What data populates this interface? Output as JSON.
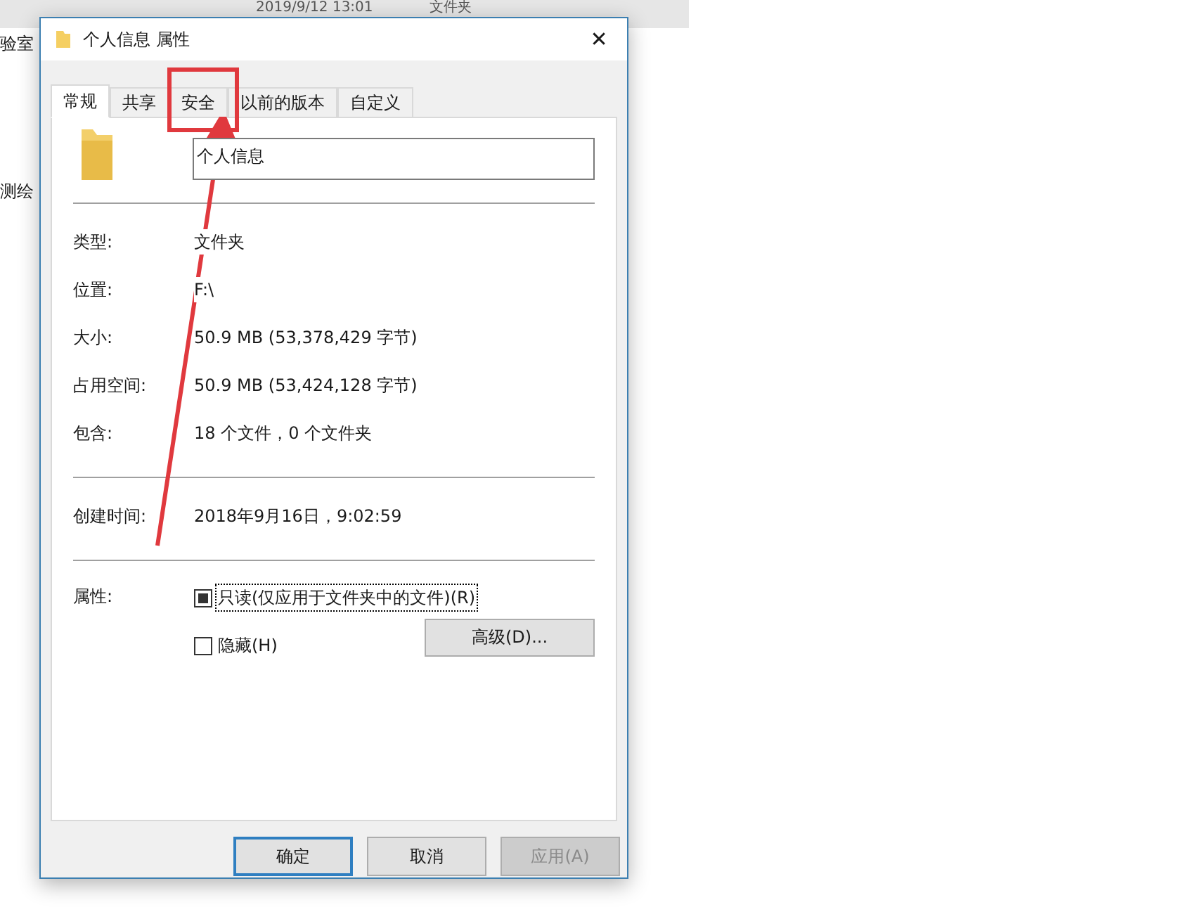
{
  "background": {
    "header_texts": [
      "2019/9/12 13:01",
      "文件夹"
    ],
    "side_texts": [
      "验室",
      "测绘"
    ]
  },
  "window": {
    "title": "个人信息 属性",
    "close": "✕"
  },
  "tabs": [
    {
      "label": "常规",
      "selected": true
    },
    {
      "label": "共享",
      "selected": false
    },
    {
      "label": "安全",
      "selected": false,
      "highlighted": true
    },
    {
      "label": "以前的版本",
      "selected": false
    },
    {
      "label": "自定义",
      "selected": false
    }
  ],
  "name_field": {
    "value": "个人信息"
  },
  "info_groups": [
    [
      {
        "label": "类型:",
        "value": "文件夹"
      },
      {
        "label": "位置:",
        "value": "F:\\"
      },
      {
        "label": "大小:",
        "value": "50.9 MB (53,378,429 字节)"
      },
      {
        "label": "占用空间:",
        "value": "50.9 MB (53,424,128 字节)"
      },
      {
        "label": "包含:",
        "value": "18 个文件，0 个文件夹"
      }
    ],
    [
      {
        "label": "创建时间:",
        "value": "2018年9月16日，9:02:59"
      }
    ]
  ],
  "attributes": {
    "label": "属性:",
    "checkboxes": [
      {
        "label": "只读(仅应用于文件夹中的文件)(R)",
        "checked": false,
        "indeterminate": true,
        "focused": true
      },
      {
        "label": "隐藏(H)",
        "checked": false,
        "indeterminate": false,
        "focused": false
      }
    ],
    "advanced_button": "高级(D)..."
  },
  "buttons": [
    {
      "label": "确定",
      "default": true,
      "disabled": false
    },
    {
      "label": "取消",
      "default": false,
      "disabled": false
    },
    {
      "label": "应用(A)",
      "default": false,
      "disabled": true
    }
  ]
}
